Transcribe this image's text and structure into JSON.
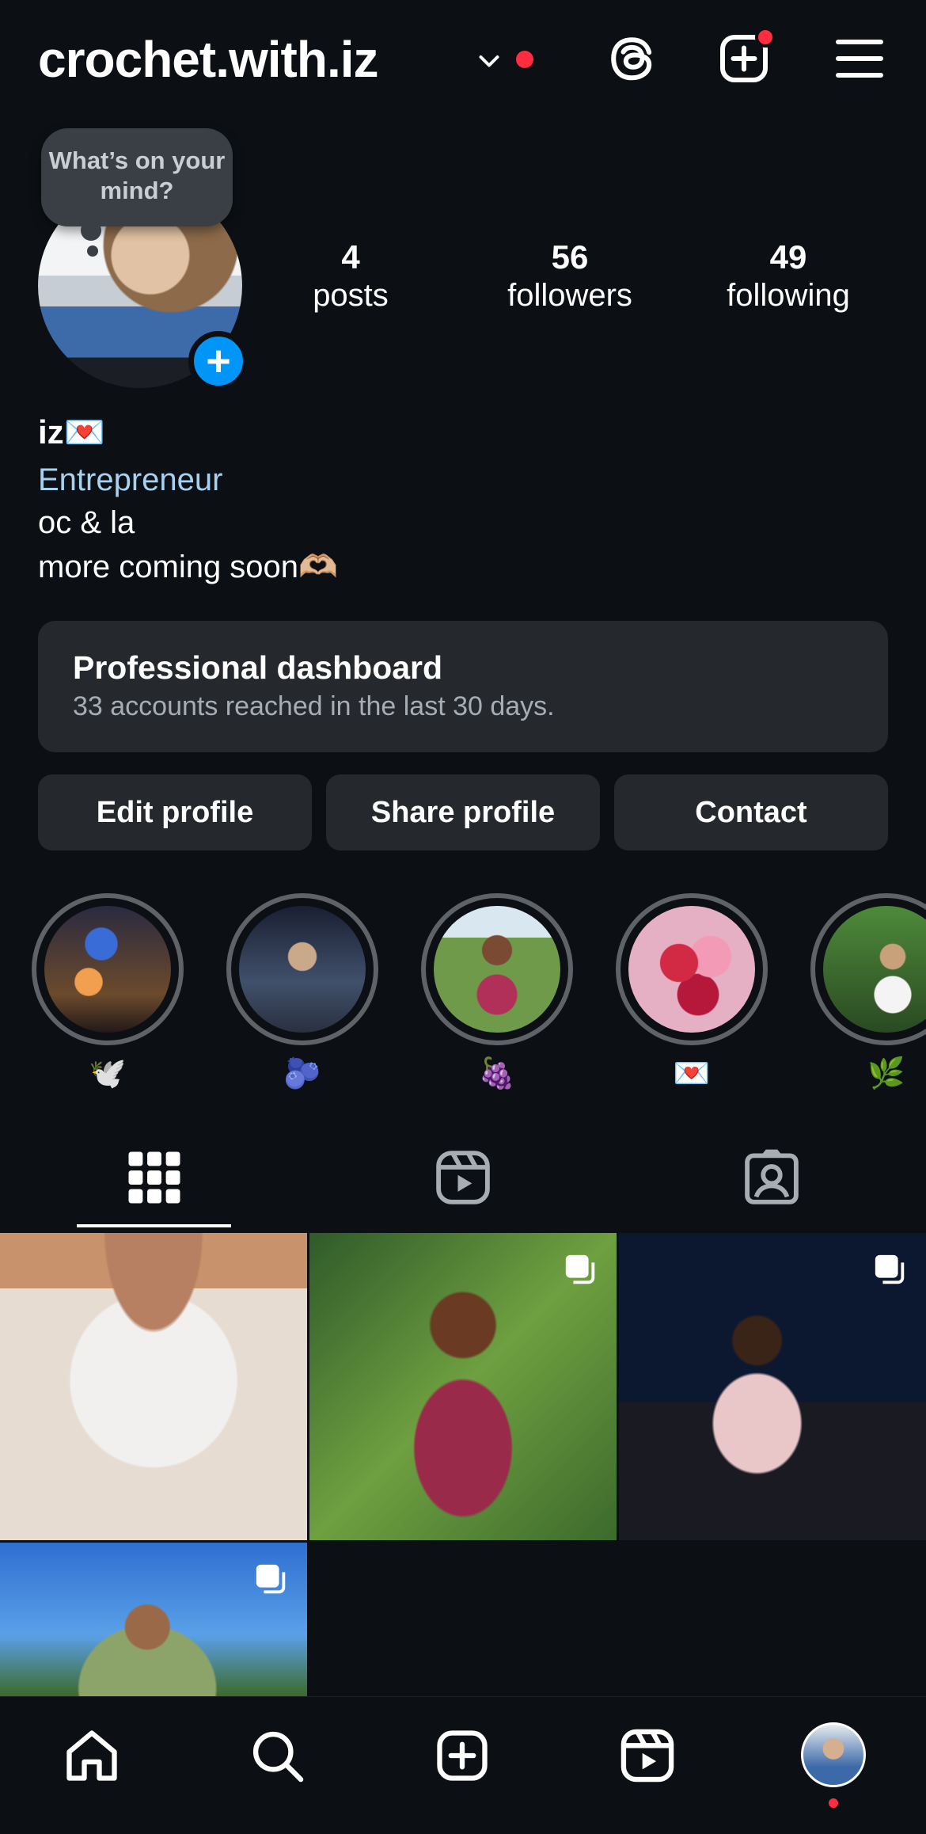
{
  "header": {
    "username": "crochet.with.iz"
  },
  "bubble": {
    "text": "What’s on your mind?"
  },
  "stats": [
    {
      "num": "4",
      "label": "posts"
    },
    {
      "num": "56",
      "label": "followers"
    },
    {
      "num": "49",
      "label": "following"
    }
  ],
  "bio": {
    "name": "iz💌",
    "category": "Entrepreneur",
    "lines": [
      "oc & la",
      "more coming soon🫶🏼"
    ]
  },
  "dashboard": {
    "title": "Professional dashboard",
    "subtitle": "33 accounts reached in the last 30 days."
  },
  "buttons": {
    "edit": "Edit profile",
    "share": "Share profile",
    "contact": "Contact"
  },
  "highlights": [
    {
      "emoji": "🕊️"
    },
    {
      "emoji": "🫐"
    },
    {
      "emoji": "🍇"
    },
    {
      "emoji": "💌"
    },
    {
      "emoji": "🌿"
    }
  ],
  "colors": {
    "background": "#0c1014",
    "accent_blue": "#0095f6",
    "notification_red": "#ff2d3f",
    "link_blue": "#a6d2f0"
  }
}
